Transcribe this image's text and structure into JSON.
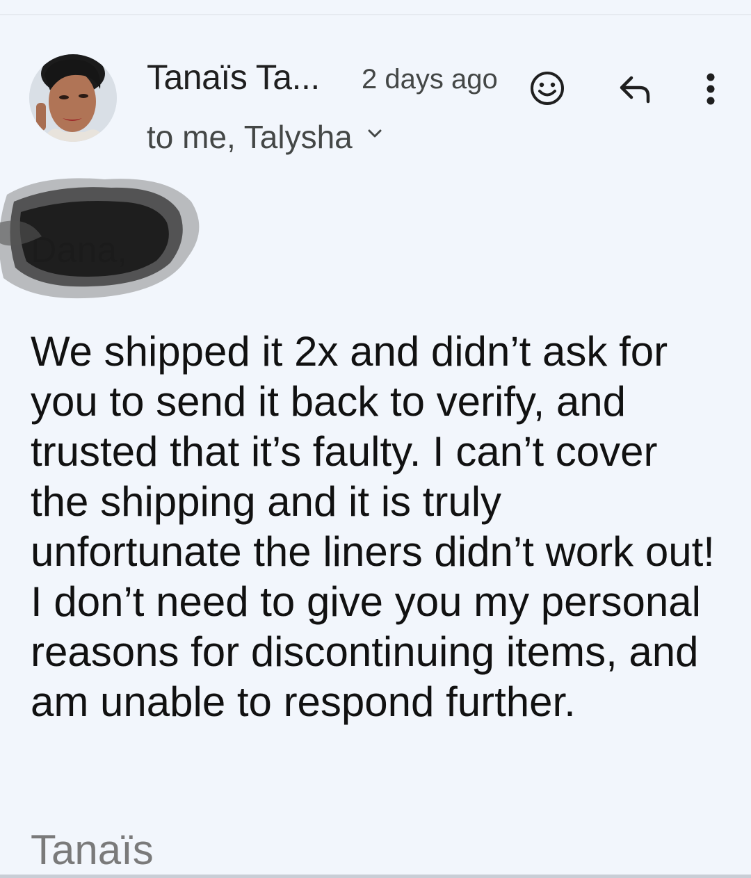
{
  "email": {
    "sender_name": "Tanaïs Ta...",
    "timestamp": "2 days ago",
    "recipients": "to me, Talysha",
    "greeting": "Dana,",
    "body": "We shipped it 2x and didn’t ask for you to send it back to verify, and trusted that it’s faulty. I can’t cover the shipping and it is truly unfortunate the liners didn’t work out! I don’t need to give you my personal reasons for discontinuing items, and am unable to respond further.",
    "signature": "Tanaïs"
  },
  "icons": {
    "emoji": "add-reaction-icon",
    "reply": "reply-icon",
    "more": "more-vert-icon",
    "expand": "chevron-down-icon"
  },
  "colors": {
    "background": "#f2f6fc",
    "primary_text": "#1f1f1f",
    "secondary_text": "#444746",
    "signature_text": "#7a7a7a"
  }
}
